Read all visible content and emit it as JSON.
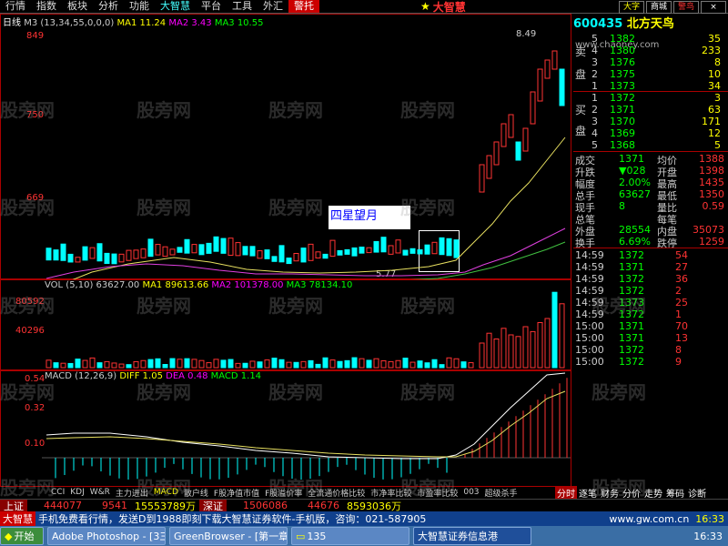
{
  "menu": [
    "行情",
    "指数",
    "板块",
    "分析",
    "功能",
    "大智慧",
    "平台",
    "工具",
    "外汇",
    "警托"
  ],
  "brand": "大智慧",
  "window_buttons": [
    "大字",
    "商城",
    "警鸟"
  ],
  "stock": {
    "code": "600435",
    "name": "北方天鸟",
    "site": "www.chaoney.com"
  },
  "period_label": "日线",
  "ma_legend": {
    "ma3": "M3 (13,34,55,0,0,0)",
    "ma1": "MA1 11.24",
    "ma2": "MA2 3.43",
    "ma3v": "MA3 10.55"
  },
  "price_axis": [
    "849",
    "750",
    "669"
  ],
  "price_high_marker": "8.49",
  "price_low_marker": "5.77",
  "annotation": "四星望月",
  "vol_legend": {
    "title": "VOL (5,10)",
    "v": "63627.00",
    "ma1": "MA1 89613.66",
    "ma2": "MA2 101378.00",
    "ma3": "MA3 78134.10"
  },
  "vol_axis": [
    "80592",
    "40296"
  ],
  "macd_legend": {
    "title": "MACD (12,26,9)",
    "diff": "DIFF 1.05",
    "dea": "DEA 0.48",
    "macd": "MACD 1.14"
  },
  "macd_axis": [
    "0.54",
    "0.32",
    "0.10"
  ],
  "indicator_tabs": [
    "CCI",
    "KDJ",
    "W&R",
    "主力进出",
    "MACD",
    "散户线",
    "F股净值市值",
    "F股溢价率",
    "全流通价格比较",
    "市净率比较",
    "市盈率比较",
    "003",
    "超级杀手"
  ],
  "orderbook": {
    "sell_label": [
      "卖",
      "盘"
    ],
    "sells": [
      {
        "lvl": "5",
        "p": "1382",
        "v": "35"
      },
      {
        "lvl": "4",
        "p": "1380",
        "v": "233"
      },
      {
        "lvl": "3",
        "p": "1376",
        "v": "8"
      },
      {
        "lvl": "2",
        "p": "1375",
        "v": "10"
      },
      {
        "lvl": "1",
        "p": "1373",
        "v": "34"
      }
    ],
    "buy_label": [
      "买",
      "盘"
    ],
    "buys": [
      {
        "lvl": "1",
        "p": "1372",
        "v": "3"
      },
      {
        "lvl": "2",
        "p": "1371",
        "v": "63"
      },
      {
        "lvl": "3",
        "p": "1370",
        "v": "171"
      },
      {
        "lvl": "4",
        "p": "1369",
        "v": "12"
      },
      {
        "lvl": "5",
        "p": "1368",
        "v": "5"
      }
    ]
  },
  "stats": [
    {
      "l1": "成交",
      "v1": "1371",
      "l2": "均价",
      "v2": "1388"
    },
    {
      "l1": "升跌",
      "v1": "▼028",
      "l2": "开盘",
      "v2": "1398"
    },
    {
      "l1": "幅度",
      "v1": "2.00%",
      "l2": "最高",
      "v2": "1435"
    },
    {
      "l1": "总手",
      "v1": "63627",
      "l2": "最低",
      "v2": "1350"
    },
    {
      "l1": "现手",
      "v1": "8",
      "l2": "量比",
      "v2": "0.59"
    },
    {
      "l1": "总笔",
      "v1": "",
      "l2": "每笔",
      "v2": ""
    },
    {
      "l1": "外盘",
      "v1": "28554",
      "l2": "内盘",
      "v2": "35073"
    },
    {
      "l1": "换手",
      "v1": "6.69%",
      "l2": "跌停",
      "v2": "1259"
    }
  ],
  "ticks": [
    {
      "t": "14:59",
      "p": "1372",
      "v": "54"
    },
    {
      "t": "14:59",
      "p": "1371",
      "v": "27"
    },
    {
      "t": "14:59",
      "p": "1372",
      "v": "36"
    },
    {
      "t": "14:59",
      "p": "1372",
      "v": "2"
    },
    {
      "t": "14:59",
      "p": "1373",
      "v": "25"
    },
    {
      "t": "14:59",
      "p": "1372",
      "v": "1"
    },
    {
      "t": "15:00",
      "p": "1371",
      "v": "70"
    },
    {
      "t": "15:00",
      "p": "1371",
      "v": "13"
    },
    {
      "t": "15:00",
      "p": "1372",
      "v": "8"
    },
    {
      "t": "15:00",
      "p": "1372",
      "v": "9"
    }
  ],
  "right_tabs": [
    "分时",
    "逐笔",
    "财务",
    "分价",
    "走势",
    "筹码",
    "诊断"
  ],
  "status_bottom": {
    "a": "上证",
    "b": "444077",
    "c": "9541",
    "d": "15553789万",
    "e": "深证",
    "f": "1506086",
    "g": "44676",
    "h": "8593036万"
  },
  "ticker": {
    "brand": "大智慧",
    "msg": "手机免费看行情，发送D到1988即刻下载大智慧证券软件-手机版，咨询：021-587905",
    "site": "www.gw.com.cn",
    "time": "16:33"
  },
  "taskbar": {
    "start": "开始",
    "tasks": [
      "Adobe Photoshop - [3三...",
      "GreenBrowser - [第一章...",
      "135",
      "大智慧证券信息港"
    ],
    "clock": "16:33"
  },
  "watermark": "股旁网"
}
